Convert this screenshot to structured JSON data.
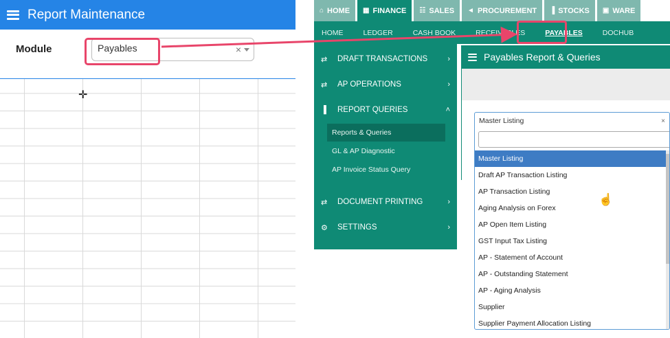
{
  "left": {
    "header_title": "Report Maintenance",
    "module_label": "Module",
    "module_value": "Payables",
    "clear_glyph": "×"
  },
  "top_tabs": [
    {
      "label": "HOME",
      "icon": "home-icon",
      "glyph": "⌂"
    },
    {
      "label": "FINANCE",
      "icon": "bank-icon",
      "glyph": "▦"
    },
    {
      "label": "SALES",
      "icon": "cart-icon",
      "glyph": "☷"
    },
    {
      "label": "PROCUREMENT",
      "icon": "megaphone-icon",
      "glyph": "◄"
    },
    {
      "label": "STOCKS",
      "icon": "bar-chart-icon",
      "glyph": "▐"
    },
    {
      "label": "WARE",
      "icon": "warehouse-icon",
      "glyph": "▣"
    }
  ],
  "sub_tabs": [
    "HOME",
    "LEDGER",
    "CASH BOOK",
    "RECEIVABLES",
    "PAYABLES",
    "DOCHUB"
  ],
  "menu": {
    "items": [
      {
        "label": "DRAFT TRANSACTIONS",
        "icon": "swap-icon",
        "glyph": "⇄",
        "chev": "›"
      },
      {
        "label": "AP OPERATIONS",
        "icon": "swap-icon",
        "glyph": "⇄",
        "chev": "›"
      },
      {
        "label": "REPORT QUERIES",
        "icon": "chart-icon",
        "glyph": "▐",
        "chev": "˄"
      },
      {
        "label": "DOCUMENT PRINTING",
        "icon": "swap-icon",
        "glyph": "⇄",
        "chev": "›"
      },
      {
        "label": "SETTINGS",
        "icon": "cogs-icon",
        "glyph": "⚙",
        "chev": "›"
      }
    ],
    "report_subitems": [
      "Reports & Queries",
      "GL & AP Diagnostic",
      "AP Invoice Status Query"
    ]
  },
  "panel": {
    "title": "Payables Report & Queries"
  },
  "dropdown": {
    "value": "Master Listing",
    "clear_glyph": "×",
    "options": [
      "Master Listing",
      "Draft AP Transaction Listing",
      "AP Transaction Listing",
      "Aging Analysis on Forex",
      "AP Open Item Listing",
      "GST Input Tax Listing",
      "AP - Statement of Account",
      "AP - Outstanding Statement",
      "AP - Aging Analysis",
      "Supplier",
      "Supplier Payment Allocation Listing"
    ]
  },
  "colors": {
    "header_blue": "#2584e6",
    "teal": "#0f8a75",
    "highlight_pink": "#e8456a",
    "selected_blue": "#3e7cc4"
  }
}
